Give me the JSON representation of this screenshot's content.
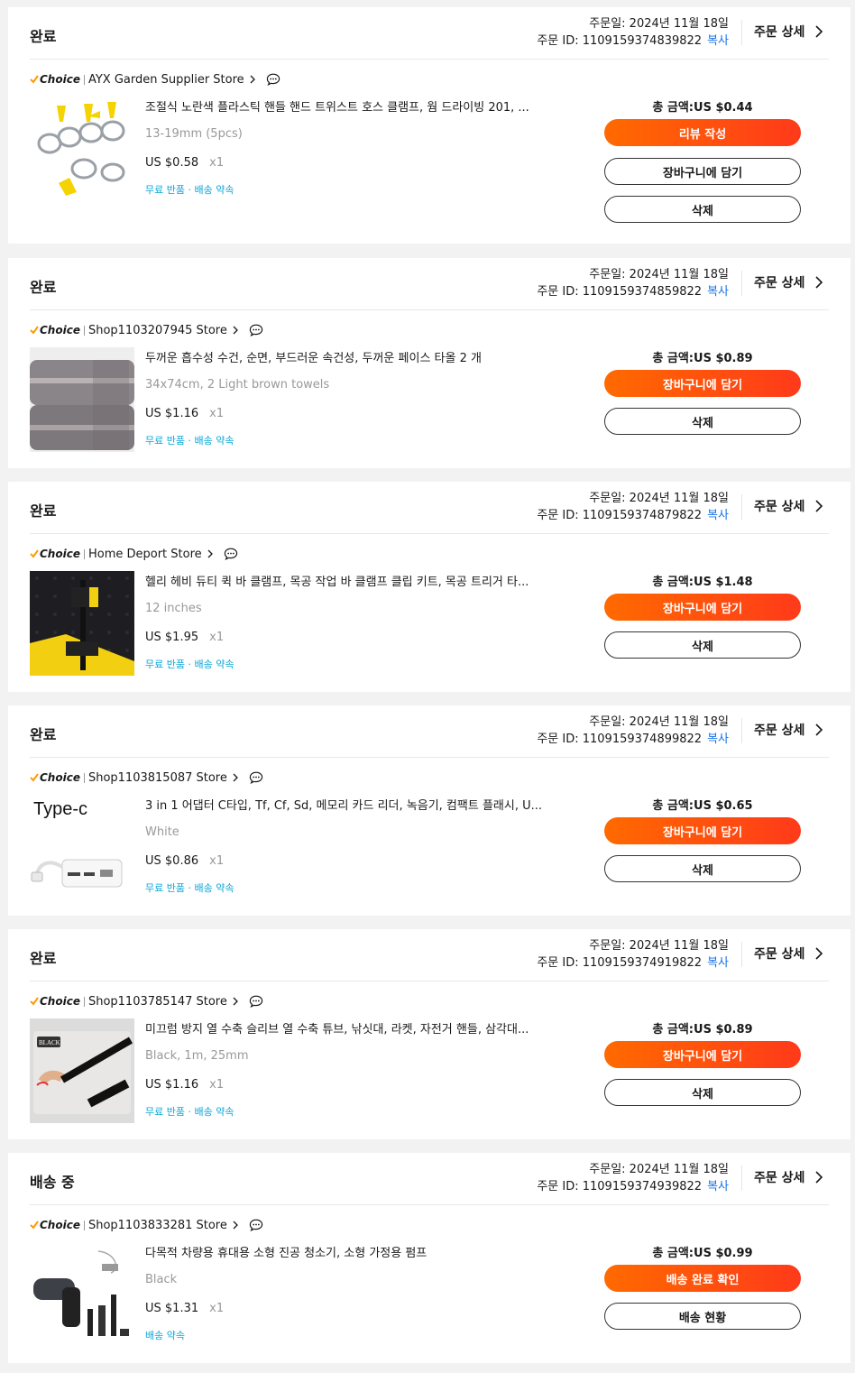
{
  "orders": [
    {
      "status": "완료",
      "order_date": "주문일: 2024년 11월 18일",
      "order_id": "주문 ID: 1109159374839822",
      "copy_label": "복사",
      "detail_label": "주문 상세",
      "choice_label": "Choice",
      "store": "AYX Garden Supplier Store",
      "product_name": "조절식 노란색 플라스틱 핸들 핸드 트위스트 호스 클램프, 웜 드라이빙 201, ...",
      "variant": "13-19mm (5pcs)",
      "price": "US $0.58",
      "qty": "x1",
      "promise": "무료 반품 · 배송 약속",
      "total": "총 금액:US $0.44",
      "buttons": [
        "리뷰 작성",
        "장바구니에 담기",
        "삭제"
      ],
      "thumb_icon": "hose-clamp-image"
    },
    {
      "status": "완료",
      "order_date": "주문일: 2024년 11월 18일",
      "order_id": "주문 ID: 1109159374859822",
      "copy_label": "복사",
      "detail_label": "주문 상세",
      "choice_label": "Choice",
      "store": "Shop1103207945 Store",
      "product_name": "두꺼운 흡수성 수건, 순면, 부드러운 속건성, 두꺼운 페이스 타올 2 개",
      "variant": "34x74cm, 2 Light brown towels",
      "price": "US $1.16",
      "qty": "x1",
      "promise": "무료 반품 · 배송 약속",
      "total": "총 금액:US $0.89",
      "buttons": [
        "장바구니에 담기",
        "삭제"
      ],
      "thumb_icon": "towel-image"
    },
    {
      "status": "완료",
      "order_date": "주문일: 2024년 11월 18일",
      "order_id": "주문 ID: 1109159374879822",
      "copy_label": "복사",
      "detail_label": "주문 상세",
      "choice_label": "Choice",
      "store": "Home Deport Store",
      "product_name": "헬리 헤비 듀티 퀵 바 클램프, 목공 작업 바 클램프 클립 키트, 목공 트리거 타...",
      "variant": "12 inches",
      "price": "US $1.95",
      "qty": "x1",
      "promise": "무료 반품 · 배송 약속",
      "total": "총 금액:US $1.48",
      "buttons": [
        "장바구니에 담기",
        "삭제"
      ],
      "thumb_icon": "bar-clamp-image"
    },
    {
      "status": "완료",
      "order_date": "주문일: 2024년 11월 18일",
      "order_id": "주문 ID: 1109159374899822",
      "copy_label": "복사",
      "detail_label": "주문 상세",
      "choice_label": "Choice",
      "store": "Shop1103815087 Store",
      "product_name": "3 in 1 어댑터 C타입, Tf, Cf, Sd, 메모리 카드 리더, 녹음기, 컴팩트 플래시, U...",
      "variant": "White",
      "price": "US $0.86",
      "qty": "x1",
      "promise": "무료 반품 · 배송 약속",
      "total": "총 금액:US $0.65",
      "buttons": [
        "장바구니에 담기",
        "삭제"
      ],
      "thumb_icon": "card-reader-image",
      "thumb_text": "Type-c"
    },
    {
      "status": "완료",
      "order_date": "주문일: 2024년 11월 18일",
      "order_id": "주문 ID: 1109159374919822",
      "copy_label": "복사",
      "detail_label": "주문 상세",
      "choice_label": "Choice",
      "store": "Shop1103785147 Store",
      "product_name": "미끄럼 방지 열 수축 슬리브 열 수축 튜브, 낚싯대, 라켓, 자전거 핸들, 삼각대...",
      "variant": "Black, 1m, 25mm",
      "price": "US $1.16",
      "qty": "x1",
      "promise": "무료 반품 · 배송 약속",
      "total": "총 금액:US $0.89",
      "buttons": [
        "장바구니에 담기",
        "삭제"
      ],
      "thumb_icon": "shrink-tube-image",
      "thumb_text": "BLACK"
    },
    {
      "status": "배송 중",
      "order_date": "주문일: 2024년 11월 18일",
      "order_id": "주문 ID: 1109159374939822",
      "copy_label": "복사",
      "detail_label": "주문 상세",
      "choice_label": "Choice",
      "store": "Shop1103833281 Store",
      "product_name": "다목적 차량용 휴대용 소형 진공 청소기, 소형 가정용 펌프",
      "variant": "Black",
      "price": "US $1.31",
      "qty": "x1",
      "promise": "배송 약속",
      "total": "총 금액:US $0.99",
      "buttons": [
        "배송 완료 확인",
        "배송 현황"
      ],
      "thumb_icon": "vacuum-image"
    }
  ],
  "colors": {
    "accent_start": "#ff6a00",
    "accent_end": "#ff3a1a",
    "link_blue": "#1a73e8",
    "promise_blue": "#0aa7d6",
    "muted": "#999999"
  }
}
